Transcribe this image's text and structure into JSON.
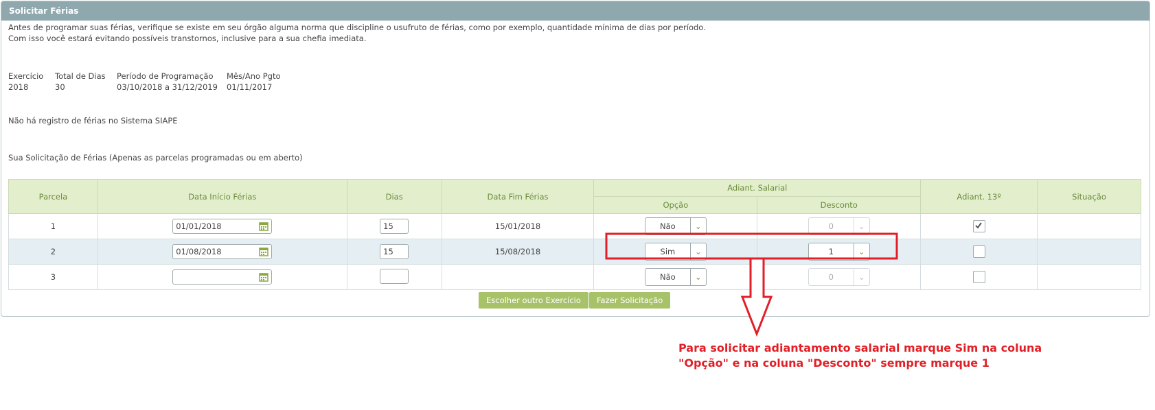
{
  "panel": {
    "title": "Solicitar Férias",
    "intro_line1": "Antes de programar suas férias, verifique se existe em seu órgão alguma norma que discipline o usufruto de férias, como por exemplo, quantidade mínima de dias por período.",
    "intro_line2": "Com isso você estará evitando possíveis transtornos, inclusive para a sua chefia imediata."
  },
  "info": {
    "exercicio_label": "Exercício",
    "exercicio_value": "2018",
    "total_label": "Total de Dias",
    "total_value": "30",
    "periodo_label": "Período de Programação",
    "periodo_value": "03/10/2018 a 31/12/2019",
    "mes_label": "Mês/Ano Pgto",
    "mes_value": "01/11/2017"
  },
  "messages": {
    "no_record": "Não há registro de férias no Sistema SIAPE",
    "solicitacao": "Sua Solicitação de Férias (Apenas as parcelas programadas ou em aberto)"
  },
  "table": {
    "headers": {
      "parcela": "Parcela",
      "data_inicio": "Data Início Férias",
      "dias": "Dias",
      "data_fim": "Data Fim Férias",
      "adiant_salarial": "Adiant. Salarial",
      "opcao": "Opção",
      "desconto": "Desconto",
      "adiant_13": "Adiant. 13º",
      "situacao": "Situação"
    },
    "rows": [
      {
        "parcela": "1",
        "data_inicio": "01/01/2018",
        "dias": "15",
        "data_fim": "15/01/2018",
        "opcao": "Não",
        "desconto": "0",
        "adiant_13": true,
        "situacao": ""
      },
      {
        "parcela": "2",
        "data_inicio": "01/08/2018",
        "dias": "15",
        "data_fim": "15/08/2018",
        "opcao": "Sim",
        "desconto": "1",
        "adiant_13": false,
        "situacao": ""
      },
      {
        "parcela": "3",
        "data_inicio": "",
        "dias": "",
        "data_fim": "",
        "opcao": "Não",
        "desconto": "0",
        "adiant_13": false,
        "situacao": ""
      }
    ]
  },
  "buttons": {
    "escolher": "Escolher outro Exercício",
    "fazer": "Fazer Solicitação"
  },
  "annotation": {
    "line1": "Para solicitar adiantamento salarial marque Sim na coluna",
    "line2": "\"Opção\" e na coluna \"Desconto\" sempre marque 1",
    "color": "#e21f26"
  },
  "colors": {
    "header_bg": "#8fa8ae",
    "table_header_bg": "#e3efcc",
    "button_bg": "#a8c26a"
  }
}
